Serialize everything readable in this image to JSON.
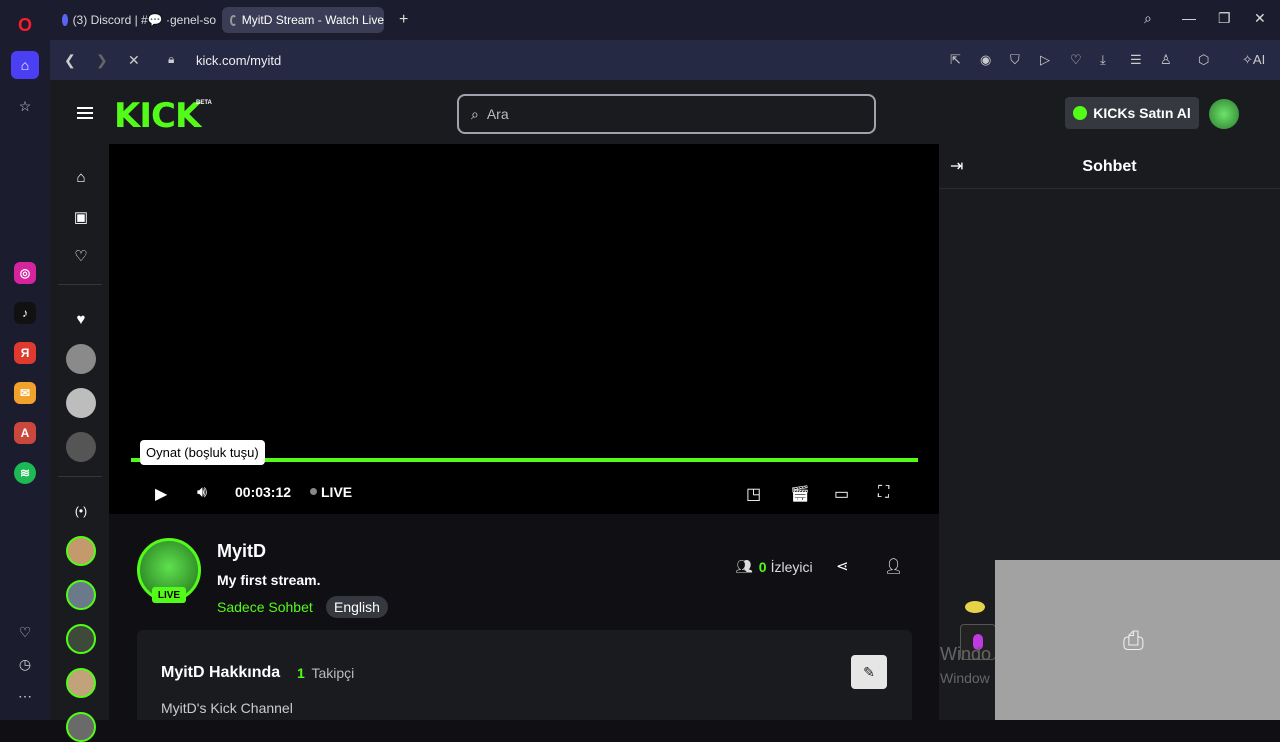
{
  "browser": {
    "tabs": [
      {
        "label": "(3) Discord | #💬 ·genel-so"
      },
      {
        "label": "MyitD Stream - Watch Live"
      }
    ],
    "url": "kick.com/myitd",
    "ai_label": "AI"
  },
  "header": {
    "logo": "KICK",
    "beta": "BETA",
    "search_placeholder": "Ara",
    "kicks_label": "KICKs Satın Al"
  },
  "player": {
    "tooltip": "Oynat (boşluk tuşu)",
    "time": "00:03:12",
    "live_label": "LIVE"
  },
  "chat": {
    "title": "Sohbet"
  },
  "channel": {
    "name": "MyitD",
    "stream_title": "My first stream.",
    "category": "Sadece Sohbet",
    "tag": "English",
    "live_badge": "LIVE",
    "viewers_count": "0",
    "viewers_label": "İzleyici"
  },
  "about": {
    "title": "MyitD Hakkında",
    "followers_count": "1",
    "followers_label": "Takipçi",
    "description": "MyitD's Kick Channel"
  },
  "overlay": {
    "watermark_line1": "Windo",
    "watermark_line2": "Window"
  },
  "colors": {
    "kick_green": "#53fc18",
    "opera_rail": "#1b1d2e"
  }
}
